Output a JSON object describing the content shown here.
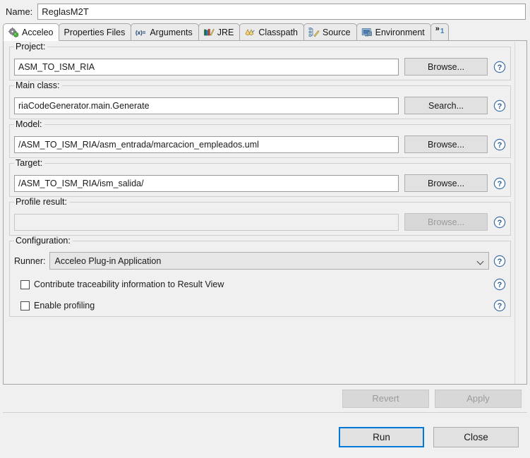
{
  "window": {
    "name_label": "Name:",
    "name_value": "ReglasM2T"
  },
  "tabs": [
    {
      "label": "Acceleo",
      "icon": "acceleo-gear-icon",
      "selected": true
    },
    {
      "label": "Properties Files",
      "icon": "properties-files-icon",
      "selected": false
    },
    {
      "label": "Arguments",
      "icon": "arguments-xeq-icon",
      "selected": false
    },
    {
      "label": "JRE",
      "icon": "jre-books-icon",
      "selected": false
    },
    {
      "label": "Classpath",
      "icon": "classpath-icon",
      "selected": false
    },
    {
      "label": "Source",
      "icon": "source-icon",
      "selected": false
    },
    {
      "label": "Environment",
      "icon": "environment-icon",
      "selected": false
    }
  ],
  "tab_overflow": {
    "chevron": "»",
    "count": "1"
  },
  "groups": [
    {
      "title": "Project:",
      "value": "ASM_TO_ISM_RIA",
      "placeholder": "",
      "button": "Browse...",
      "disabled": false,
      "help": "help-icon"
    },
    {
      "title": "Main class:",
      "value": "riaCodeGenerator.main.Generate",
      "placeholder": "",
      "button": "Search...",
      "disabled": false,
      "help": "help-icon"
    },
    {
      "title": "Model:",
      "value": "/ASM_TO_ISM_RIA/asm_entrada/marcacion_empleados.uml",
      "placeholder": "",
      "button": "Browse...",
      "disabled": false,
      "help": "help-icon"
    },
    {
      "title": "Target:",
      "value": "/ASM_TO_ISM_RIA/ism_salida/",
      "placeholder": "",
      "button": "Browse...",
      "disabled": false,
      "help": "help-icon"
    },
    {
      "title": "Profile result:",
      "value": "",
      "placeholder": "",
      "button": "Browse...",
      "disabled": true,
      "help": "help-icon"
    }
  ],
  "configuration": {
    "title": "Configuration:",
    "runner_label": "Runner:",
    "runner_value": "Acceleo Plug-in Application",
    "runner_options": [
      "Acceleo Plug-in Application"
    ],
    "checkboxes": [
      {
        "label": "Contribute traceability information to Result View",
        "checked": false
      },
      {
        "label": "Enable profiling",
        "checked": false
      }
    ]
  },
  "apply_bar": {
    "revert": "Revert",
    "apply": "Apply",
    "revert_enabled": false,
    "apply_enabled": false
  },
  "footer": {
    "run": "Run",
    "close": "Close"
  },
  "colors": {
    "accent": "#0078d7",
    "dialog_bg": "#f0f0f0",
    "field_bg": "#ffffff",
    "help_blue": "#3a6ea5"
  }
}
